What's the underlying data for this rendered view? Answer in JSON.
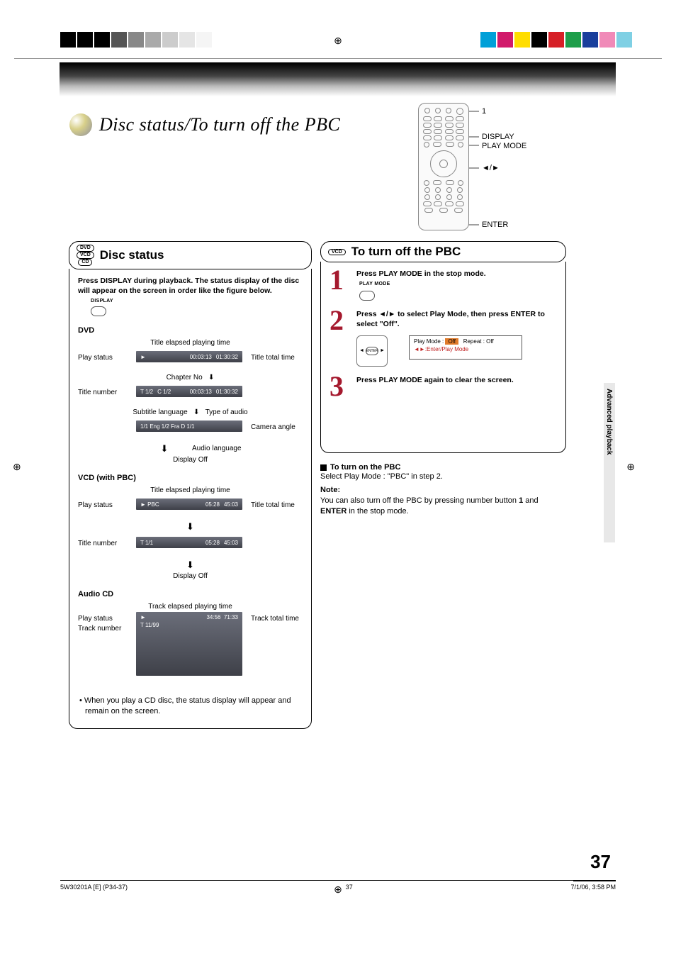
{
  "page_title": "Disc status/To turn off the PBC",
  "remote_labels": {
    "one": "1",
    "display": "DISPLAY",
    "play_mode": "PLAY MODE",
    "arrows": "◄/►",
    "enter": "ENTER"
  },
  "side_tab": "Advanced playback",
  "page_number": "37",
  "footer": {
    "left": "5W30201A [E] (P34-37)",
    "center": "37",
    "right": "7/1/06, 3:58 PM"
  },
  "disc_status": {
    "badges": {
      "dvd": "DVD",
      "vcd": "VCD",
      "cd": "CD"
    },
    "title": "Disc status",
    "lead": "Press DISPLAY during playback. The status display of the disc will appear on the screen in order like the figure below.",
    "display_btn": "DISPLAY",
    "sections": {
      "dvd": {
        "head": "DVD",
        "top_anno": "Title elapsed playing time",
        "left1": "Play status",
        "right1": "Title total time",
        "osd1": {
          "play": "►",
          "t1": "00:03:13",
          "t2": "01:30:32"
        },
        "mid1": "Chapter No",
        "left2": "Title number",
        "osd2": {
          "T": "T 1/2",
          "C": "C 1/2",
          "t1": "00:03:13",
          "t2": "01:30:32"
        },
        "sub_lang": "Subtitle language",
        "audio_type": "Type of audio",
        "osd3": "1/1 Eng  1/2 Fra  D  1/1",
        "camera": "Camera angle",
        "audio_lang": "Audio language",
        "dispoff": "Display Off"
      },
      "vcd": {
        "head": "VCD (with PBC)",
        "top_anno": "Title elapsed playing time",
        "left1": "Play status",
        "right1": "Title total time",
        "osd1": {
          "play": "► PBC",
          "t1": "05:28",
          "t2": "45:03"
        },
        "left2": "Title number",
        "osd2": {
          "T": "T 1/1",
          "t1": "05:28",
          "t2": "45:03"
        },
        "dispoff": "Display Off"
      },
      "cd": {
        "head": "Audio CD",
        "top_anno": "Track elapsed playing time",
        "left1": "Play status",
        "left2": "Track number",
        "right1": "Track total time",
        "osd1": {
          "play": "►",
          "T": "T 11/99",
          "t1": "34:56",
          "t2": "71:33"
        }
      }
    },
    "cd_note": "• When you play a CD disc, the status display will appear and remain on the screen."
  },
  "pbc": {
    "badge": "VCD",
    "title": "To turn off the PBC",
    "steps": {
      "s1": {
        "txt": "Press PLAY MODE in the stop mode.",
        "btn": "PLAY MODE"
      },
      "s2": {
        "txt": "Press ◄/► to select Play Mode, then press ENTER to select \"Off\".",
        "enter": "ENTER",
        "box": {
          "line1a": "Play Mode :",
          "off": "Off",
          "line1b": "Repeat : Off",
          "line2": "◄►:Enter/Play Mode"
        }
      },
      "s3": {
        "txt": "Press PLAY MODE again to clear the screen."
      }
    },
    "turn_on_hd": "To turn on the PBC",
    "turn_on_body": "Select Play Mode : \"PBC\" in step 2.",
    "note_hd": "Note:",
    "note_body_a": "You can also turn off the PBC by pressing number button ",
    "note_body_1": "1",
    "note_body_b": " and ",
    "note_body_enter": "ENTER",
    "note_body_c": " in the stop mode."
  }
}
